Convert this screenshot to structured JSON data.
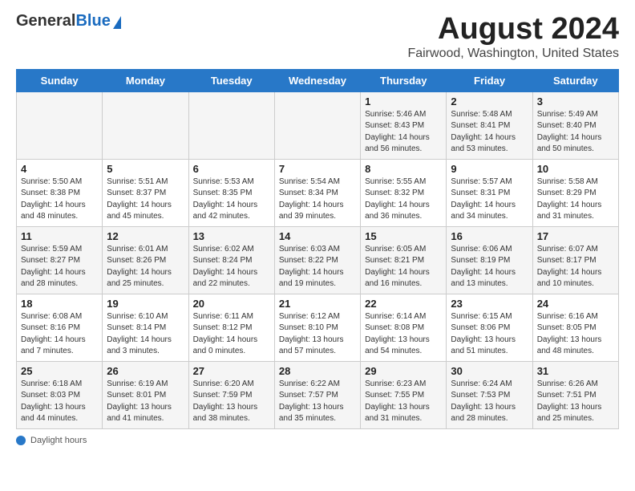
{
  "header": {
    "logo_general": "General",
    "logo_blue": "Blue",
    "month_title": "August 2024",
    "location": "Fairwood, Washington, United States"
  },
  "calendar": {
    "days_of_week": [
      "Sunday",
      "Monday",
      "Tuesday",
      "Wednesday",
      "Thursday",
      "Friday",
      "Saturday"
    ],
    "weeks": [
      [
        {
          "day": "",
          "info": ""
        },
        {
          "day": "",
          "info": ""
        },
        {
          "day": "",
          "info": ""
        },
        {
          "day": "",
          "info": ""
        },
        {
          "day": "1",
          "info": "Sunrise: 5:46 AM\nSunset: 8:43 PM\nDaylight: 14 hours\nand 56 minutes."
        },
        {
          "day": "2",
          "info": "Sunrise: 5:48 AM\nSunset: 8:41 PM\nDaylight: 14 hours\nand 53 minutes."
        },
        {
          "day": "3",
          "info": "Sunrise: 5:49 AM\nSunset: 8:40 PM\nDaylight: 14 hours\nand 50 minutes."
        }
      ],
      [
        {
          "day": "4",
          "info": "Sunrise: 5:50 AM\nSunset: 8:38 PM\nDaylight: 14 hours\nand 48 minutes."
        },
        {
          "day": "5",
          "info": "Sunrise: 5:51 AM\nSunset: 8:37 PM\nDaylight: 14 hours\nand 45 minutes."
        },
        {
          "day": "6",
          "info": "Sunrise: 5:53 AM\nSunset: 8:35 PM\nDaylight: 14 hours\nand 42 minutes."
        },
        {
          "day": "7",
          "info": "Sunrise: 5:54 AM\nSunset: 8:34 PM\nDaylight: 14 hours\nand 39 minutes."
        },
        {
          "day": "8",
          "info": "Sunrise: 5:55 AM\nSunset: 8:32 PM\nDaylight: 14 hours\nand 36 minutes."
        },
        {
          "day": "9",
          "info": "Sunrise: 5:57 AM\nSunset: 8:31 PM\nDaylight: 14 hours\nand 34 minutes."
        },
        {
          "day": "10",
          "info": "Sunrise: 5:58 AM\nSunset: 8:29 PM\nDaylight: 14 hours\nand 31 minutes."
        }
      ],
      [
        {
          "day": "11",
          "info": "Sunrise: 5:59 AM\nSunset: 8:27 PM\nDaylight: 14 hours\nand 28 minutes."
        },
        {
          "day": "12",
          "info": "Sunrise: 6:01 AM\nSunset: 8:26 PM\nDaylight: 14 hours\nand 25 minutes."
        },
        {
          "day": "13",
          "info": "Sunrise: 6:02 AM\nSunset: 8:24 PM\nDaylight: 14 hours\nand 22 minutes."
        },
        {
          "day": "14",
          "info": "Sunrise: 6:03 AM\nSunset: 8:22 PM\nDaylight: 14 hours\nand 19 minutes."
        },
        {
          "day": "15",
          "info": "Sunrise: 6:05 AM\nSunset: 8:21 PM\nDaylight: 14 hours\nand 16 minutes."
        },
        {
          "day": "16",
          "info": "Sunrise: 6:06 AM\nSunset: 8:19 PM\nDaylight: 14 hours\nand 13 minutes."
        },
        {
          "day": "17",
          "info": "Sunrise: 6:07 AM\nSunset: 8:17 PM\nDaylight: 14 hours\nand 10 minutes."
        }
      ],
      [
        {
          "day": "18",
          "info": "Sunrise: 6:08 AM\nSunset: 8:16 PM\nDaylight: 14 hours\nand 7 minutes."
        },
        {
          "day": "19",
          "info": "Sunrise: 6:10 AM\nSunset: 8:14 PM\nDaylight: 14 hours\nand 3 minutes."
        },
        {
          "day": "20",
          "info": "Sunrise: 6:11 AM\nSunset: 8:12 PM\nDaylight: 14 hours\nand 0 minutes."
        },
        {
          "day": "21",
          "info": "Sunrise: 6:12 AM\nSunset: 8:10 PM\nDaylight: 13 hours\nand 57 minutes."
        },
        {
          "day": "22",
          "info": "Sunrise: 6:14 AM\nSunset: 8:08 PM\nDaylight: 13 hours\nand 54 minutes."
        },
        {
          "day": "23",
          "info": "Sunrise: 6:15 AM\nSunset: 8:06 PM\nDaylight: 13 hours\nand 51 minutes."
        },
        {
          "day": "24",
          "info": "Sunrise: 6:16 AM\nSunset: 8:05 PM\nDaylight: 13 hours\nand 48 minutes."
        }
      ],
      [
        {
          "day": "25",
          "info": "Sunrise: 6:18 AM\nSunset: 8:03 PM\nDaylight: 13 hours\nand 44 minutes."
        },
        {
          "day": "26",
          "info": "Sunrise: 6:19 AM\nSunset: 8:01 PM\nDaylight: 13 hours\nand 41 minutes."
        },
        {
          "day": "27",
          "info": "Sunrise: 6:20 AM\nSunset: 7:59 PM\nDaylight: 13 hours\nand 38 minutes."
        },
        {
          "day": "28",
          "info": "Sunrise: 6:22 AM\nSunset: 7:57 PM\nDaylight: 13 hours\nand 35 minutes."
        },
        {
          "day": "29",
          "info": "Sunrise: 6:23 AM\nSunset: 7:55 PM\nDaylight: 13 hours\nand 31 minutes."
        },
        {
          "day": "30",
          "info": "Sunrise: 6:24 AM\nSunset: 7:53 PM\nDaylight: 13 hours\nand 28 minutes."
        },
        {
          "day": "31",
          "info": "Sunrise: 6:26 AM\nSunset: 7:51 PM\nDaylight: 13 hours\nand 25 minutes."
        }
      ]
    ]
  },
  "footer": {
    "note": "Daylight hours"
  }
}
